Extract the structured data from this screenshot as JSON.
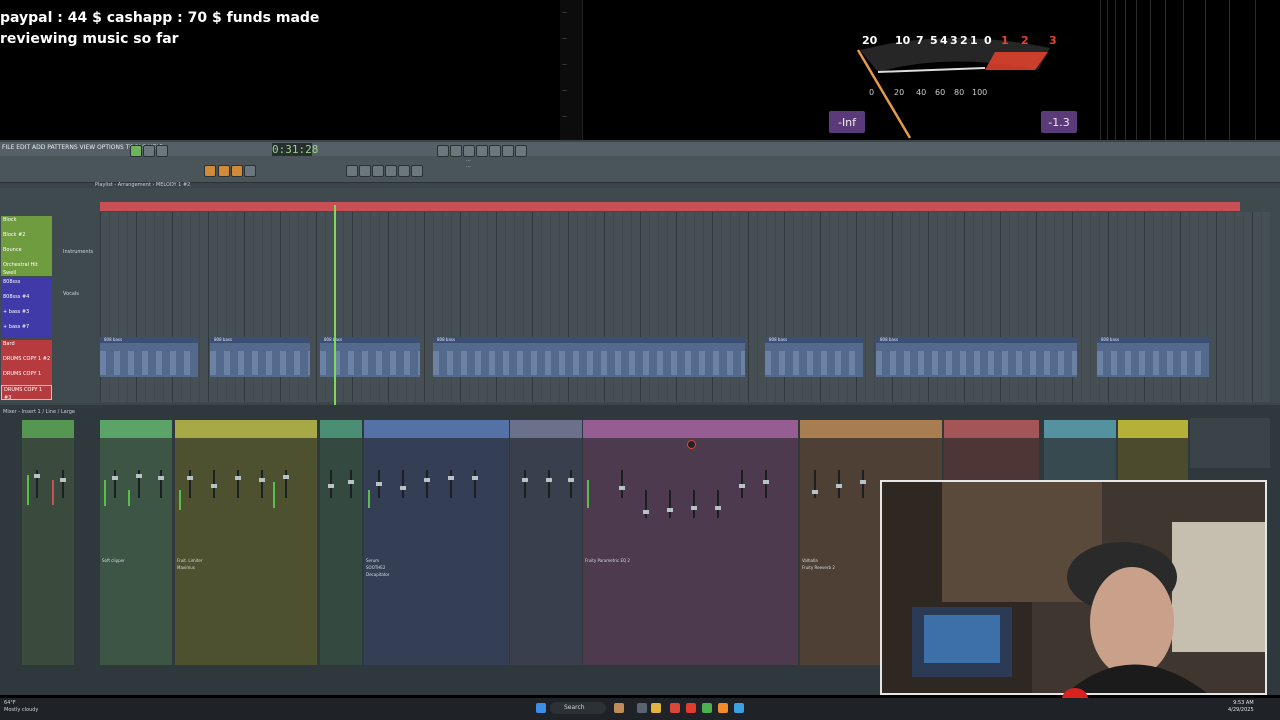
{
  "overlay": {
    "funds_line1": "paypal : 44 $  cashapp : 70 $ funds made",
    "funds_line2": "reviewing music so far",
    "vu_meter": {
      "top_scale": [
        "20",
        "10",
        "7",
        "5",
        "4",
        "3",
        "2",
        "1",
        "0",
        "1",
        "2",
        "3"
      ],
      "bottom_scale": [
        "0",
        "20",
        "40",
        "60",
        "80",
        "100"
      ],
      "left_readout": "-Inf",
      "right_readout": "-1.3",
      "colors": {
        "red": "#e8432e",
        "white": "#ffffff",
        "purple": "#5a3a78"
      }
    }
  },
  "fl_studio": {
    "menu": "FILE  EDIT  ADD  PATTERNS  VIEW  OPTIONS  TOOLS  HELP",
    "time_display": "0:31:28",
    "playlist": {
      "title": "Playlist - Arrangement › MELODY 1 #2",
      "instruments_label": "Instruments",
      "vocals_label": "Vocals",
      "tracks": [
        {
          "label": "Block",
          "color": "#6f9c3e"
        },
        {
          "label": "Block #2",
          "color": "#6f9c3e"
        },
        {
          "label": "Bounce",
          "color": "#6f9c3e"
        },
        {
          "label": "Orchestral Hit Swell",
          "color": "#6f9c3e"
        },
        {
          "label": "808sss",
          "color": "#3f3aa8"
        },
        {
          "label": "808sss #4",
          "color": "#3f3aa8"
        },
        {
          "label": "+ bass #3",
          "color": "#3f3aa8"
        },
        {
          "label": "+ bass #7",
          "color": "#3f3aa8"
        },
        {
          "label": "Bard",
          "color": "#b63b3f"
        },
        {
          "label": "DRUMS COPY 1 #2",
          "color": "#b63b3f"
        },
        {
          "label": "DRUMS COPY 1",
          "color": "#b63b3f"
        },
        {
          "label": "DRUMS COPY 1 #3",
          "color": "#b63b3f"
        }
      ],
      "clip_label": "808 bass"
    },
    "mixer": {
      "title": "Mixer - Insert 1 / Line / Large",
      "fx_labels": [
        "Soft clipper",
        "Fruit. Limiter",
        "Maximus",
        "Fruity Delay 3",
        "Serum",
        "SOOTHE2",
        "Decapitator",
        "Fruity Parametric EQ 2",
        "Valhalla",
        "Fruity Reeverb 2"
      ]
    }
  },
  "taskbar": {
    "weather": "64°F\nMostly cloudy",
    "search": "Search",
    "time": "9:53 AM",
    "date": "4/29/2025"
  }
}
